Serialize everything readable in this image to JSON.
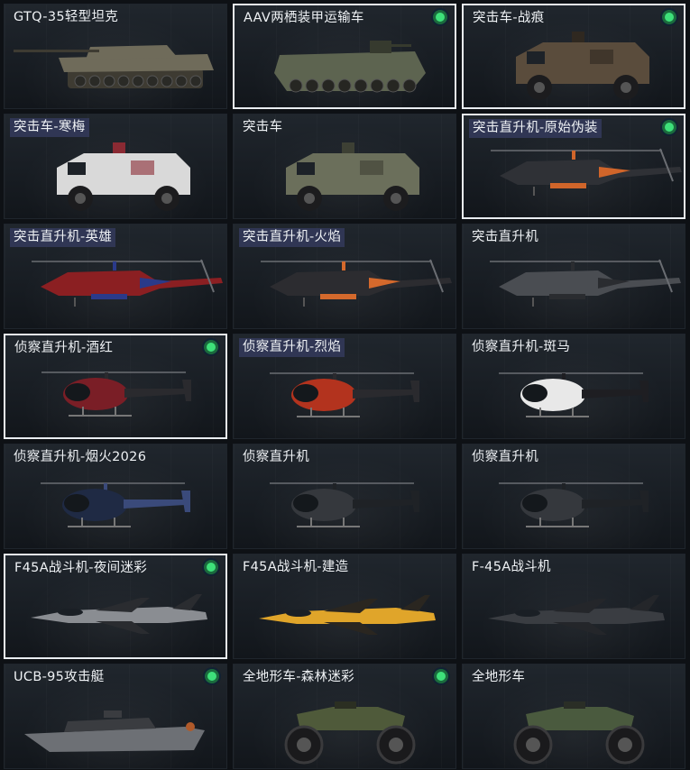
{
  "items": [
    {
      "name": "GTQ-35轻型坦克",
      "type": "tank",
      "colors": [
        "#6f6b5a",
        "#3e3b32"
      ],
      "selected": false,
      "owned": false,
      "label_highlight": false
    },
    {
      "name": "AAV两栖装甲运输车",
      "type": "apc",
      "colors": [
        "#5d6450",
        "#363a2e"
      ],
      "selected": true,
      "owned": true,
      "label_highlight": false
    },
    {
      "name": "突击车-战痕",
      "type": "truck",
      "colors": [
        "#5a4c3c",
        "#2f2820"
      ],
      "selected": true,
      "owned": true,
      "label_highlight": false
    },
    {
      "name": "突击车-寒梅",
      "type": "truck",
      "colors": [
        "#d9d9d9",
        "#8a2a33"
      ],
      "selected": false,
      "owned": false,
      "label_highlight": true
    },
    {
      "name": "突击车",
      "type": "truck",
      "colors": [
        "#6b6f5b",
        "#3d4034"
      ],
      "selected": false,
      "owned": false,
      "label_highlight": false
    },
    {
      "name": "突击直升机-原始伪装",
      "type": "attack-heli",
      "colors": [
        "#2f3136",
        "#d0652a"
      ],
      "selected": true,
      "owned": true,
      "label_highlight": true
    },
    {
      "name": "突击直升机-英雄",
      "type": "attack-heli",
      "colors": [
        "#8b1f22",
        "#2a3a8a"
      ],
      "selected": false,
      "owned": false,
      "label_highlight": true
    },
    {
      "name": "突击直升机-火焰",
      "type": "attack-heli",
      "colors": [
        "#2c2c30",
        "#d4692c"
      ],
      "selected": false,
      "owned": false,
      "label_highlight": true
    },
    {
      "name": "突击直升机",
      "type": "attack-heli",
      "colors": [
        "#4a4d52",
        "#2a2c30"
      ],
      "selected": false,
      "owned": false,
      "label_highlight": false
    },
    {
      "name": "侦察直升机-酒红",
      "type": "scout-heli",
      "colors": [
        "#7a1e26",
        "#2a2a2e"
      ],
      "selected": true,
      "owned": true,
      "label_highlight": false
    },
    {
      "name": "侦察直升机-烈焰",
      "type": "scout-heli",
      "colors": [
        "#b3331e",
        "#2a2a2e"
      ],
      "selected": false,
      "owned": false,
      "label_highlight": true
    },
    {
      "name": "侦察直升机-斑马",
      "type": "scout-heli",
      "colors": [
        "#e8e8e8",
        "#1e1e22"
      ],
      "selected": false,
      "owned": false,
      "label_highlight": false
    },
    {
      "name": "侦察直升机-烟火2026",
      "type": "scout-heli",
      "colors": [
        "#1f2a44",
        "#3a4a7a"
      ],
      "selected": false,
      "owned": false,
      "label_highlight": false
    },
    {
      "name": "侦察直升机",
      "type": "scout-heli",
      "colors": [
        "#35383d",
        "#1f2226"
      ],
      "selected": false,
      "owned": false,
      "label_highlight": false
    },
    {
      "name": "侦察直升机",
      "type": "scout-heli",
      "colors": [
        "#35383d",
        "#1f2226"
      ],
      "selected": false,
      "owned": false,
      "label_highlight": false
    },
    {
      "name": "F45A战斗机-夜间迷彩",
      "type": "jet",
      "colors": [
        "#8a8d92",
        "#2a2c30"
      ],
      "selected": true,
      "owned": true,
      "label_highlight": false
    },
    {
      "name": "F45A战斗机-建造",
      "type": "jet",
      "colors": [
        "#e0a52a",
        "#2a2620"
      ],
      "selected": false,
      "owned": false,
      "label_highlight": false
    },
    {
      "name": "F-45A战斗机",
      "type": "jet",
      "colors": [
        "#3a3d42",
        "#24262a"
      ],
      "selected": false,
      "owned": false,
      "label_highlight": false
    },
    {
      "name": "UCB-95攻击艇",
      "type": "boat",
      "colors": [
        "#6d7075",
        "#3a3c40"
      ],
      "selected": false,
      "owned": true,
      "label_highlight": false
    },
    {
      "name": "全地形车-森林迷彩",
      "type": "atv",
      "colors": [
        "#4f5a3a",
        "#2b2f22"
      ],
      "selected": false,
      "owned": true,
      "label_highlight": false
    },
    {
      "name": "全地形车",
      "type": "atv",
      "colors": [
        "#4a5a3e",
        "#2a2e26"
      ],
      "selected": false,
      "owned": false,
      "label_highlight": false
    }
  ]
}
